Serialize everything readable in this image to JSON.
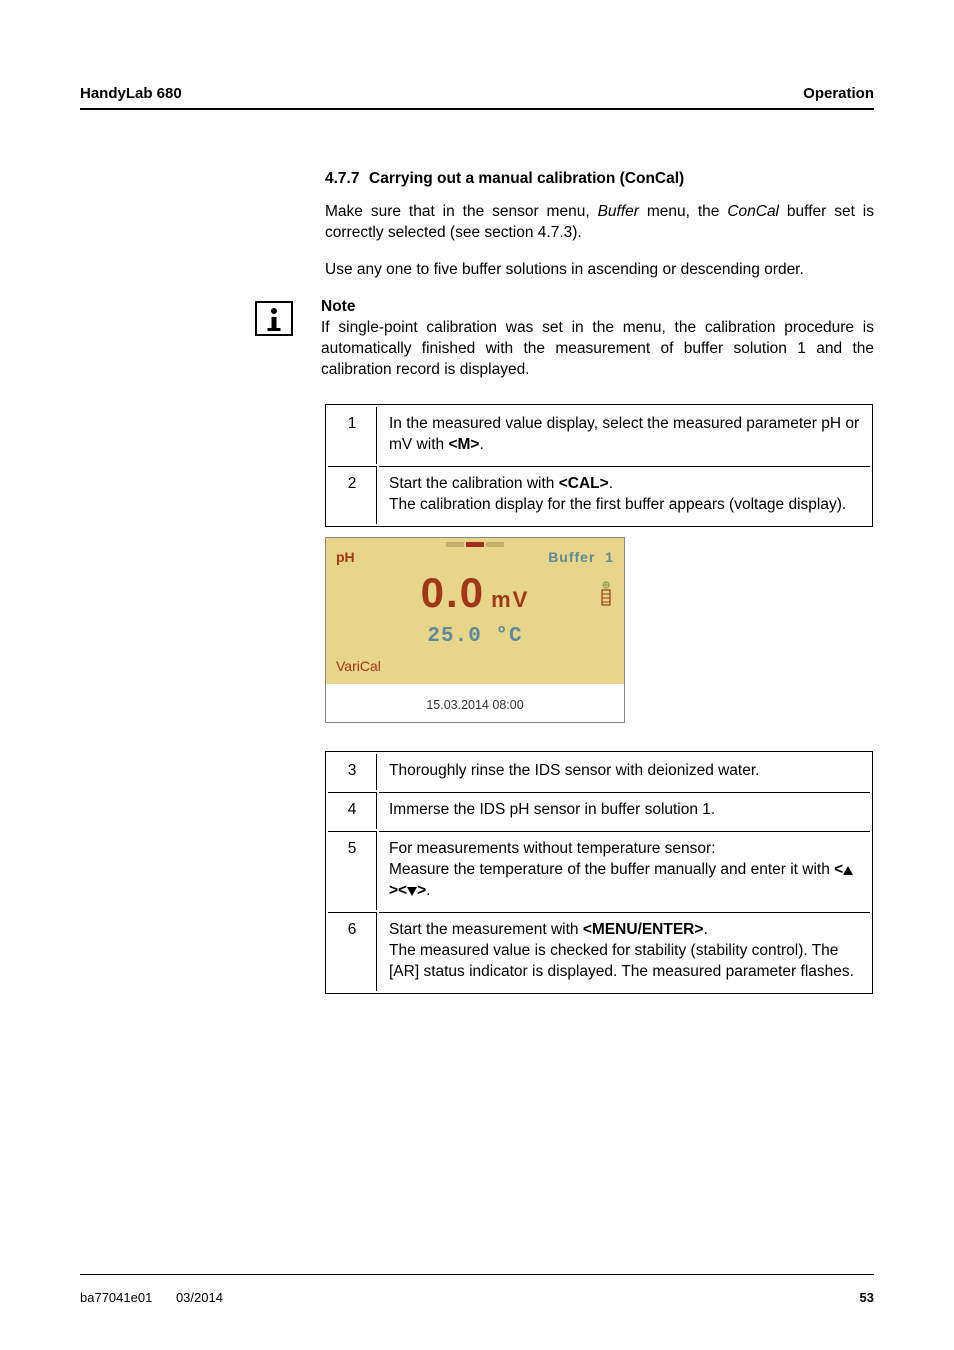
{
  "header": {
    "left": "HandyLab 680",
    "right": "Operation"
  },
  "section": {
    "number": "4.7.7",
    "title": "Carrying out a manual calibration (ConCal)"
  },
  "intro": {
    "p1_a": "Make sure that in the sensor menu, ",
    "p1_buf": "Buffer",
    "p1_b": " menu, the ",
    "p1_con": "ConCal",
    "p1_c": " buffer set is correctly selected (see section 4.7.3).",
    "p2": "Use any one to five buffer solutions in ascending or descending order."
  },
  "note": {
    "title": "Note",
    "body": "If single-point calibration was set in the menu, the calibration procedure is automatically finished with the measurement of buffer solution 1 and the calibration record is displayed."
  },
  "steps_a": [
    {
      "n": "1",
      "pre": "In the measured value display, select the measured parameter pH or mV with ",
      "key": "<M>",
      "post": "."
    },
    {
      "n": "2",
      "pre": "Start the calibration with ",
      "key": "<CAL>",
      "post": ".\nThe calibration display for the first buffer appears (voltage display)."
    }
  ],
  "display": {
    "mode": "pH",
    "buffer_label": "Buffer",
    "buffer_num": "1",
    "value": "0.0",
    "unit": "mV",
    "temp": "25.0 °C",
    "method": "VariCal",
    "datetime": "15.03.2014 08:00"
  },
  "steps_b": [
    {
      "n": "3",
      "text": "Thoroughly rinse the IDS sensor with deionized water."
    },
    {
      "n": "4",
      "text": "Immerse the IDS pH sensor in buffer solution 1."
    },
    {
      "n": "5",
      "pre": "For measurements without temperature sensor:\nMeasure the temperature of the buffer manually and enter it with ",
      "key_arrows": true,
      "post": "."
    },
    {
      "n": "6",
      "pre": "Start the measurement with ",
      "key": "<MENU/ENTER>",
      "post": ".\nThe measured value is checked for stability (stability control). The [AR] status indicator is displayed. The measured parameter flashes."
    }
  ],
  "chart_data": {
    "type": "table",
    "title": "Instrument display snapshot during ConCal calibration",
    "fields": {
      "mode": "pH",
      "buffer": 1,
      "reading_mV": 0.0,
      "temperature_C": 25.0,
      "method": "VariCal",
      "timestamp": "15.03.2014 08:00"
    }
  },
  "footer": {
    "doc": "ba77041e01",
    "date": "03/2014",
    "page": "53"
  }
}
